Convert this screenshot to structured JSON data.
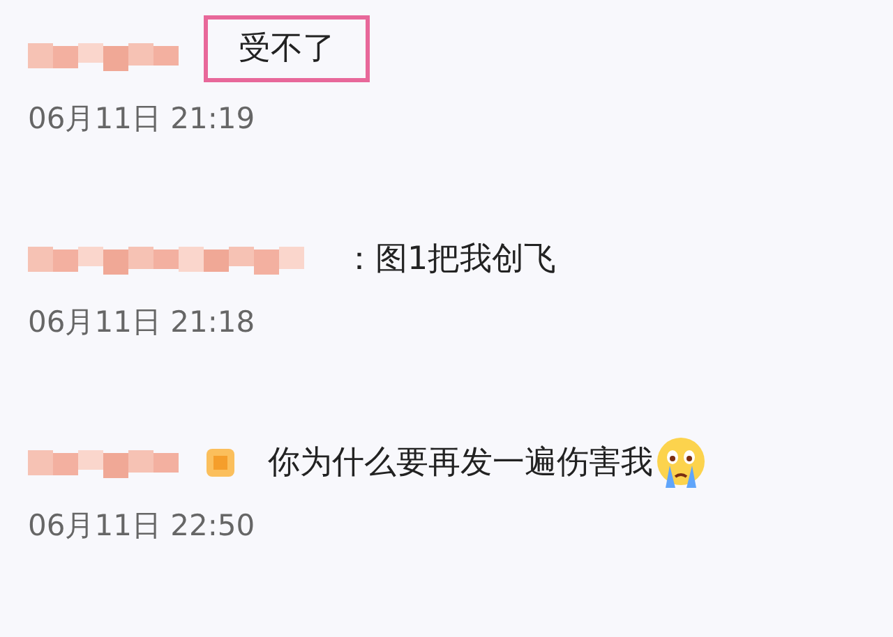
{
  "comments": [
    {
      "text": "受不了",
      "date": "06月11日 21:19",
      "highlighted": true,
      "badge": false,
      "crying_emoji": false
    },
    {
      "text": "：图1把我创飞",
      "date": "06月11日 21:18",
      "highlighted": false,
      "badge": false,
      "crying_emoji": false
    },
    {
      "text": "你为什么要再发一遍伤害我",
      "date": "06月11日 22:50",
      "highlighted": false,
      "badge": true,
      "crying_emoji": true
    }
  ]
}
